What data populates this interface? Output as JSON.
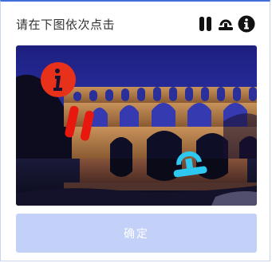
{
  "captcha": {
    "instruction": "请在下图依次点击",
    "target_icons": [
      "pause-icon",
      "lifebuoy-icon",
      "info-icon"
    ],
    "target_color": "#111111",
    "overlay_icons": [
      {
        "name": "info-icon",
        "color": "#e8311a"
      },
      {
        "name": "pause-icon",
        "color": "#e8180e"
      },
      {
        "name": "lifebuoy-icon",
        "color": "#2ec9f0"
      }
    ],
    "confirm_label": "确定",
    "confirm_color": "#c3d0f8",
    "accent_color": "#3f6fd8"
  }
}
